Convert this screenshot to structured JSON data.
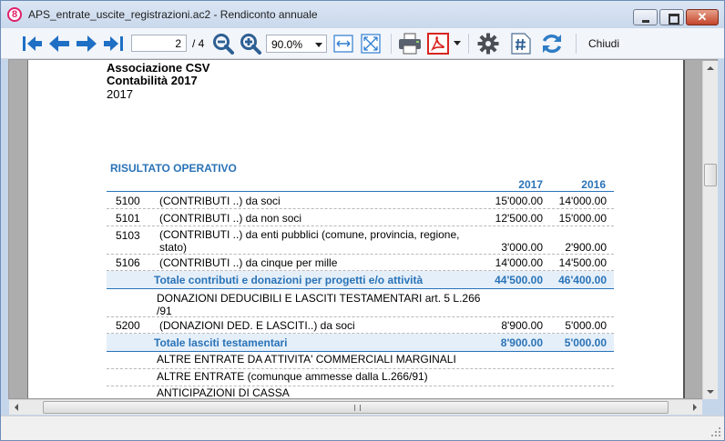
{
  "window": {
    "title": "APS_entrate_uscite_registrazioni.ac2 - Rendiconto annuale",
    "app_icon_glyph": "8"
  },
  "toolbar": {
    "page_current": "2",
    "page_total": "/ 4",
    "zoom": "90.0%",
    "close_label": "Chiudi"
  },
  "report": {
    "org_name": "Associazione CSV",
    "accounting": "Contabilità 2017",
    "year": "2017",
    "section_title": "RISULTATO OPERATIVO",
    "col_2017": "2017",
    "col_2016": "2016",
    "rows": [
      {
        "code": "5100",
        "desc": "(CONTRIBUTI ..) da soci",
        "v2017": "15'000.00",
        "v2016": "14'000.00"
      },
      {
        "code": "5101",
        "desc": "(CONTRIBUTI ..) da non soci",
        "v2017": "12'500.00",
        "v2016": "15'000.00"
      },
      {
        "code": "5103",
        "desc": "(CONTRIBUTI ..)   da enti pubblici (comune, provincia, regione, stato)",
        "v2017": "3'000.00",
        "v2016": "2'900.00"
      },
      {
        "code": "5106",
        "desc": "(CONTRIBUTI ..) da cinque per mille",
        "v2017": "14'000.00",
        "v2016": "14'500.00"
      },
      {
        "code": "",
        "desc": "Totale contributi e donazioni per progetti e/o attività",
        "v2017": "44'500.00",
        "v2016": "46'400.00"
      },
      {
        "code": "",
        "desc": "DONAZIONI DEDUCIBILI E LASCITI TESTAMENTARI art. 5 L.266 /91",
        "v2017": "",
        "v2016": ""
      },
      {
        "code": "5200",
        "desc": "(DONAZIONI DED. E LASCITI..) da soci",
        "v2017": "8'900.00",
        "v2016": "5'000.00"
      },
      {
        "code": "",
        "desc": "Totale lasciti testamentari",
        "v2017": "8'900.00",
        "v2016": "5'000.00"
      },
      {
        "code": "",
        "desc": "ALTRE ENTRATE DA ATTIVITA' COMMERCIALI MARGINALI",
        "v2017": "",
        "v2016": ""
      },
      {
        "code": "",
        "desc": "ALTRE ENTRATE (comunque ammesse dalla L.266/91)",
        "v2017": "",
        "v2016": ""
      },
      {
        "code": "",
        "desc": "ANTICIPAZIONI DI CASSA",
        "v2017": "",
        "v2016": ""
      }
    ]
  },
  "colors": {
    "accent_blue": "#2a73b8",
    "toolbar_icon_blue": "#1f6fc4",
    "pdf_red": "#d8241f"
  },
  "icons": {
    "toolbar": [
      "first-page-icon",
      "prev-page-icon",
      "next-page-icon",
      "last-page-icon",
      "zoom-out-icon",
      "zoom-in-icon",
      "fit-width-icon",
      "fit-page-icon",
      "print-icon",
      "pdf-icon",
      "settings-gear-icon",
      "hash-icon",
      "refresh-icon"
    ]
  }
}
